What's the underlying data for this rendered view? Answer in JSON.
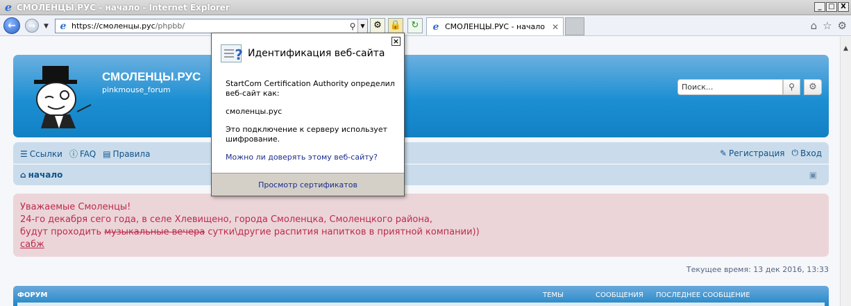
{
  "window": {
    "title": "СМОЛЕНЦЫ.РУС - начало - Internet Explorer",
    "minimize": "_",
    "maximize": "□",
    "close": "X"
  },
  "navbar": {
    "url_host": "https://смоленцы.рус",
    "url_path": "/phpbb/",
    "tab_title": "СМОЛЕНЦЫ.РУС - начало",
    "tab_close": "✕"
  },
  "header": {
    "site_title": "СМОЛЕНЦЫ.РУС",
    "site_description": "pinkmouse_forum",
    "search_placeholder": "Поиск..."
  },
  "nav": {
    "links": [
      "Ссылки",
      "FAQ",
      "Правила"
    ],
    "register": "Регистрация",
    "login": "Вход",
    "breadcrumb": "начало"
  },
  "announcement": {
    "line1": "Уважаемые Смоленцы!",
    "line2": "24-го декабря сего года, в селе Хлевищено, города Смоленцка, Смоленцкого района,",
    "line3_prefix": "будут проходить ",
    "line3_struck": "музыкальные вечера",
    "line3_suffix": " сутки\\другие распития напитков в приятной компании))",
    "link": "сабж"
  },
  "current_time": "Текущее время: 13 дек 2016, 13:33",
  "forum_table": {
    "col_forum": "Форум",
    "col_topics": "Темы",
    "col_posts": "Сообщения",
    "col_last": "Последнее сообщение"
  },
  "popup": {
    "title": "Идентификация веб-сайта",
    "text1": "StartCom Certification Authority определил веб-сайт как:",
    "text2": "смоленцы.рус",
    "text3": "Это подключение к серверу использует шифрование.",
    "link": "Можно ли доверять этому веб-сайту?",
    "footer": "Просмотр сертификатов",
    "close": "×"
  }
}
